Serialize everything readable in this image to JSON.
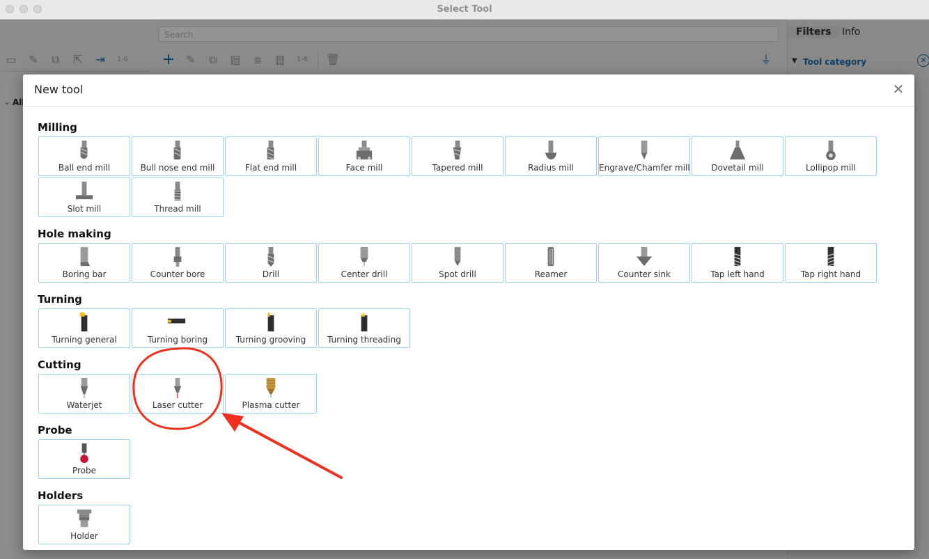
{
  "window": {
    "title": "Select Tool",
    "search_placeholder": "Search",
    "tree_root": "All",
    "right_panel": {
      "tabs": [
        "Filters",
        "Info"
      ],
      "active_tab": "Filters",
      "category_label": "Tool category"
    }
  },
  "dialog": {
    "title": "New tool",
    "sections": [
      {
        "title": "Milling",
        "tools": [
          {
            "label": "Ball end mill",
            "icon": "ball-end-mill-icon"
          },
          {
            "label": "Bull nose end mill",
            "icon": "bull-nose-end-mill-icon"
          },
          {
            "label": "Flat end mill",
            "icon": "flat-end-mill-icon"
          },
          {
            "label": "Face mill",
            "icon": "face-mill-icon"
          },
          {
            "label": "Tapered mill",
            "icon": "tapered-mill-icon"
          },
          {
            "label": "Radius mill",
            "icon": "radius-mill-icon"
          },
          {
            "label": "Engrave/Chamfer mill",
            "icon": "engrave-chamfer-mill-icon"
          },
          {
            "label": "Dovetail mill",
            "icon": "dovetail-mill-icon"
          },
          {
            "label": "Lollipop mill",
            "icon": "lollipop-mill-icon"
          },
          {
            "label": "Slot mill",
            "icon": "slot-mill-icon"
          },
          {
            "label": "Thread mill",
            "icon": "thread-mill-icon"
          }
        ]
      },
      {
        "title": "Hole making",
        "tools": [
          {
            "label": "Boring bar",
            "icon": "boring-bar-icon"
          },
          {
            "label": "Counter bore",
            "icon": "counter-bore-icon"
          },
          {
            "label": "Drill",
            "icon": "drill-icon"
          },
          {
            "label": "Center drill",
            "icon": "center-drill-icon"
          },
          {
            "label": "Spot drill",
            "icon": "spot-drill-icon"
          },
          {
            "label": "Reamer",
            "icon": "reamer-icon"
          },
          {
            "label": "Counter sink",
            "icon": "counter-sink-icon"
          },
          {
            "label": "Tap left hand",
            "icon": "tap-left-hand-icon"
          },
          {
            "label": "Tap right hand",
            "icon": "tap-right-hand-icon"
          }
        ]
      },
      {
        "title": "Turning",
        "tools": [
          {
            "label": "Turning general",
            "icon": "turning-general-icon"
          },
          {
            "label": "Turning boring",
            "icon": "turning-boring-icon"
          },
          {
            "label": "Turning grooving",
            "icon": "turning-grooving-icon"
          },
          {
            "label": "Turning threading",
            "icon": "turning-threading-icon"
          }
        ]
      },
      {
        "title": "Cutting",
        "tools": [
          {
            "label": "Waterjet",
            "icon": "waterjet-icon"
          },
          {
            "label": "Laser cutter",
            "icon": "laser-cutter-icon"
          },
          {
            "label": "Plasma cutter",
            "icon": "plasma-cutter-icon"
          }
        ]
      },
      {
        "title": "Probe",
        "tools": [
          {
            "label": "Probe",
            "icon": "probe-icon"
          }
        ]
      },
      {
        "title": "Holders",
        "tools": [
          {
            "label": "Holder",
            "icon": "holder-icon"
          }
        ]
      }
    ]
  },
  "annotation": {
    "highlighted_tool": "Laser cutter",
    "color": "#f0301e"
  },
  "colors": {
    "tile_border": "#9ed0ea",
    "accent_blue": "#1a6aa5",
    "tool_steel": "#6d6d6d",
    "turning_insert": "#f2c200",
    "plasma_gold": "#c89a3a",
    "probe_ball": "#c8163a"
  }
}
